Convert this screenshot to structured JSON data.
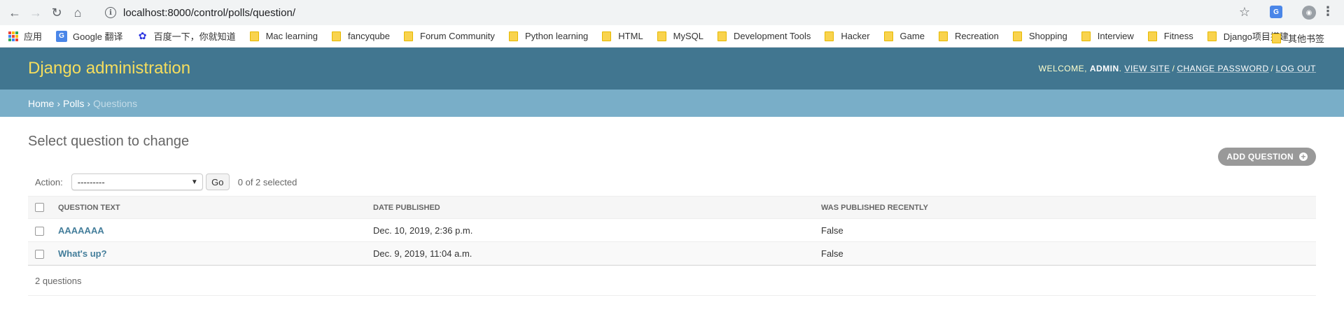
{
  "browser": {
    "url": "localhost:8000/control/polls/question/",
    "bookmarks": [
      {
        "label": "应用",
        "icon": "apps-grid-icon"
      },
      {
        "label": "Google 翻译",
        "icon": "google-translate-icon"
      },
      {
        "label": "百度一下，你就知道",
        "icon": "baidu-paw-icon"
      },
      {
        "label": "Mac learning",
        "icon": "folder-icon"
      },
      {
        "label": "fancyqube",
        "icon": "folder-icon"
      },
      {
        "label": "Forum Community",
        "icon": "folder-icon"
      },
      {
        "label": "Python learning",
        "icon": "folder-icon"
      },
      {
        "label": "HTML",
        "icon": "folder-icon"
      },
      {
        "label": "MySQL",
        "icon": "folder-icon"
      },
      {
        "label": "Development Tools",
        "icon": "folder-icon"
      },
      {
        "label": "Hacker",
        "icon": "folder-icon"
      },
      {
        "label": "Game",
        "icon": "folder-icon"
      },
      {
        "label": "Recreation",
        "icon": "folder-icon"
      },
      {
        "label": "Shopping",
        "icon": "folder-icon"
      },
      {
        "label": "Interview",
        "icon": "folder-icon"
      },
      {
        "label": "Fitness",
        "icon": "folder-icon"
      },
      {
        "label": "Django项目搭建",
        "icon": "folder-icon"
      }
    ],
    "other_bookmarks": "其他书签"
  },
  "header": {
    "branding": "Django administration",
    "welcome": "WELCOME,",
    "username": "ADMIN",
    "view_site": "VIEW SITE",
    "change_password": "CHANGE PASSWORD",
    "log_out": "LOG OUT"
  },
  "breadcrumbs": {
    "home": "Home",
    "polls": "Polls",
    "current": "Questions"
  },
  "main": {
    "title": "Select question to change",
    "add_button": "ADD QUESTION",
    "action_label": "Action:",
    "action_selected": "---------",
    "go_button": "Go",
    "selected_count": "0 of 2 selected",
    "columns": [
      "Question text",
      "Date published",
      "Was published recently"
    ],
    "rows": [
      {
        "question": "AAAAAAA",
        "date": "Dec. 10, 2019, 2:36 p.m.",
        "recent": "False"
      },
      {
        "question": "What's up?",
        "date": "Dec. 9, 2019, 11:04 a.m.",
        "recent": "False"
      }
    ],
    "paginator": "2 questions"
  },
  "colors": {
    "header_bg": "#417690",
    "branding": "#f5dd5d",
    "breadcrumbs_bg": "#79aec8",
    "link": "#447e9b"
  }
}
